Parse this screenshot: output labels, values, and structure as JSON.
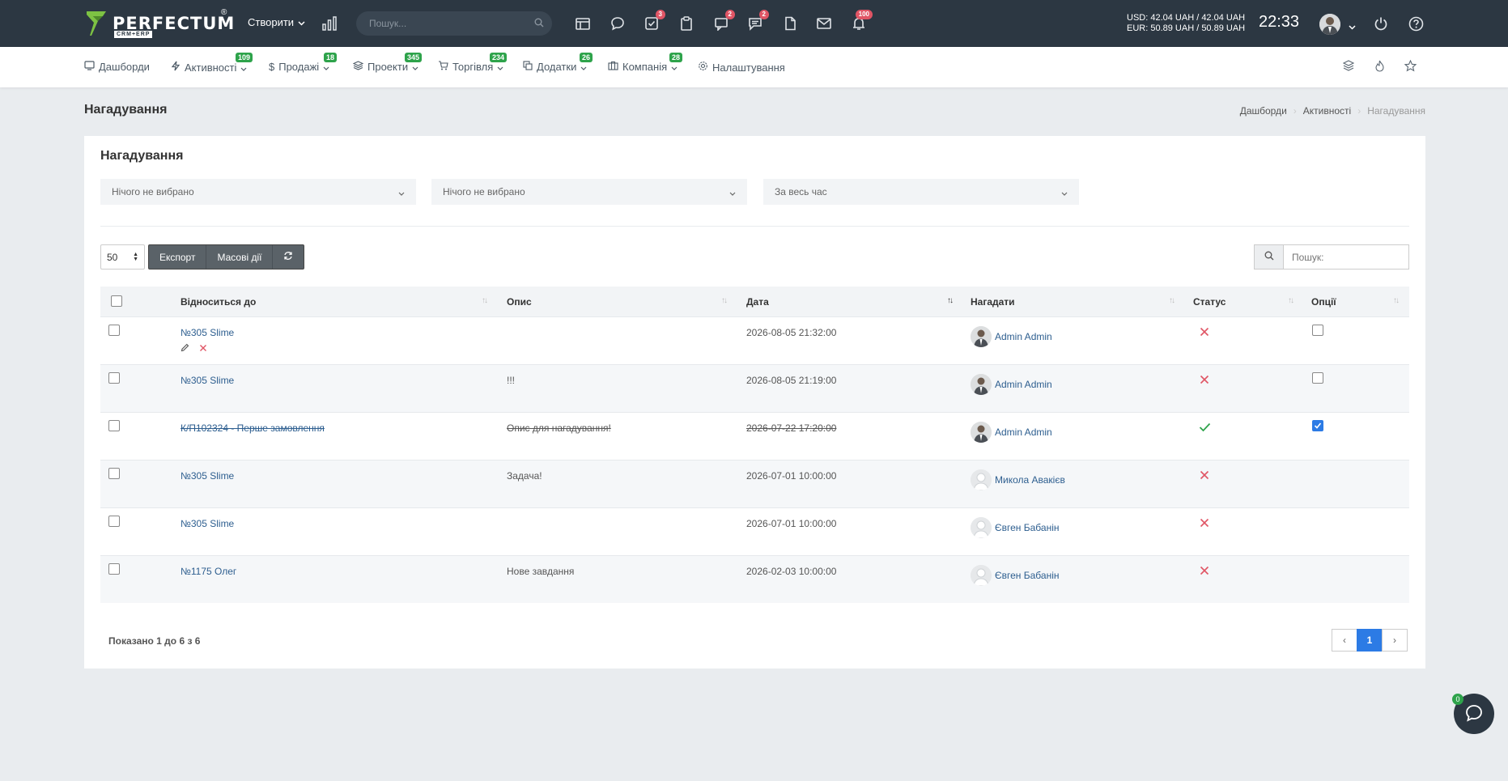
{
  "topbar": {
    "logo_text": "PERFECTUM",
    "logo_sub": "CRM+ERP",
    "logo_reg": "®",
    "create_label": "Створити",
    "search_placeholder": "Пошук...",
    "icons": [
      {
        "name": "calendar-icon",
        "badge": null
      },
      {
        "name": "chat-icon",
        "badge": null
      },
      {
        "name": "tasks-icon",
        "badge": "3"
      },
      {
        "name": "clipboard-icon",
        "badge": null
      },
      {
        "name": "support-icon",
        "badge": "2"
      },
      {
        "name": "messages-icon",
        "badge": "2"
      },
      {
        "name": "file-icon",
        "badge": null
      },
      {
        "name": "mail-icon",
        "badge": null
      },
      {
        "name": "bell-icon",
        "badge": "100"
      }
    ],
    "currency_usd": "USD: 42.04 UAH / 42.04 UAH",
    "currency_eur": "EUR: 50.89 UAH / 50.89 UAH",
    "clock": "22:33"
  },
  "subnav": {
    "items": [
      {
        "label": "Дашборди",
        "badge": null
      },
      {
        "label": "Активності",
        "badge": "109"
      },
      {
        "label": "Продажі",
        "badge": "18"
      },
      {
        "label": "Проекти",
        "badge": "345"
      },
      {
        "label": "Торгівля",
        "badge": "234"
      },
      {
        "label": "Додатки",
        "badge": "26"
      },
      {
        "label": "Компанія",
        "badge": "28"
      },
      {
        "label": "Налаштування",
        "badge": null
      }
    ]
  },
  "page": {
    "title": "Нагадування",
    "breadcrumb": [
      "Дашборди",
      "Активності",
      "Нагадування"
    ]
  },
  "panel": {
    "title": "Нагадування",
    "filters": [
      "Нічого не вибрано",
      "Нічого не вибрано",
      "За весь час"
    ],
    "page_size": "50",
    "export_label": "Експорт",
    "bulk_label": "Масові дії",
    "search_placeholder": "Пошук:",
    "columns": [
      "Відноситься до",
      "Опис",
      "Дата",
      "Нагадати",
      "Статус",
      "Опції"
    ],
    "rows": [
      {
        "rel": "№305 Slime",
        "desc": "",
        "date": "2026-08-05 21:32:00",
        "user": "Admin Admin",
        "avatar": "admin",
        "status": "cross",
        "option": "unchecked",
        "strike": false
      },
      {
        "rel": "№305 Slime",
        "desc": "!!!",
        "date": "2026-08-05 21:19:00",
        "user": "Admin Admin",
        "avatar": "admin",
        "status": "cross",
        "option": "unchecked",
        "strike": false
      },
      {
        "rel": "К/П102324 - Перше замовлення",
        "desc": "Опис для нагадування!",
        "date": "2026-07-22 17:20:00",
        "user": "Admin Admin",
        "avatar": "admin",
        "status": "check",
        "option": "checked",
        "strike": true
      },
      {
        "rel": "№305 Slime",
        "desc": "Задача!",
        "date": "2026-07-01 10:00:00",
        "user": "Микола Авакієв",
        "avatar": "default",
        "status": "cross",
        "option": "none",
        "strike": false
      },
      {
        "rel": "№305 Slime",
        "desc": "",
        "date": "2026-07-01 10:00:00",
        "user": "Євген Бабанін",
        "avatar": "default",
        "status": "cross",
        "option": "none",
        "strike": false
      },
      {
        "rel": "№1175 Олег",
        "desc": "Нове завдання",
        "date": "2026-02-03 10:00:00",
        "user": "Євген Бабанін",
        "avatar": "default",
        "status": "cross",
        "option": "none",
        "strike": false
      }
    ],
    "footer_info": "Показано 1 до 6 з 6",
    "current_page": "1"
  },
  "chat_badge": "0"
}
